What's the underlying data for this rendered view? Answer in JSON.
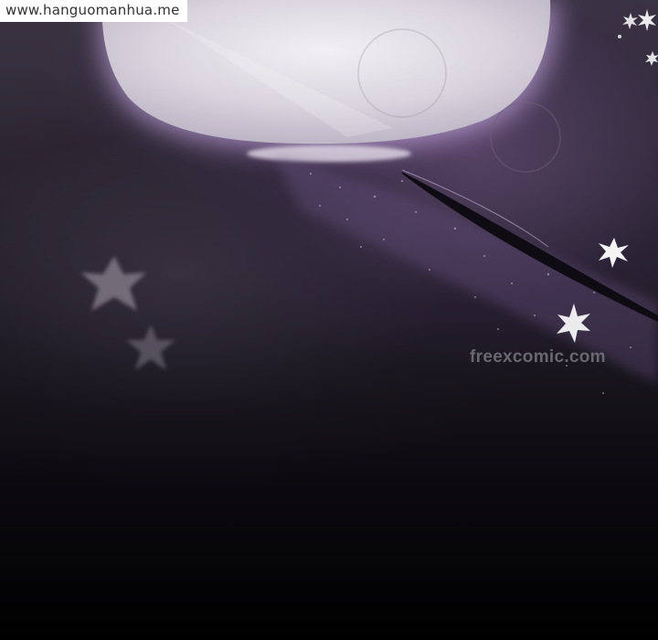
{
  "watermarks": {
    "top_left": "www.hanguomanhua.me",
    "site": "freexcomic.com"
  },
  "colors": {
    "bubble_fill": "#e6e2ea",
    "bubble_glow": "#a98ac2",
    "background_top": "#3a3442",
    "background_bottom": "#000000",
    "sparkle": "#ffffff"
  },
  "icons": {
    "sparkles": [
      "star-burst-icon",
      "star-burst-icon",
      "star-burst-icon",
      "star-burst-icon",
      "star-burst-icon",
      "star-burst-icon"
    ]
  }
}
